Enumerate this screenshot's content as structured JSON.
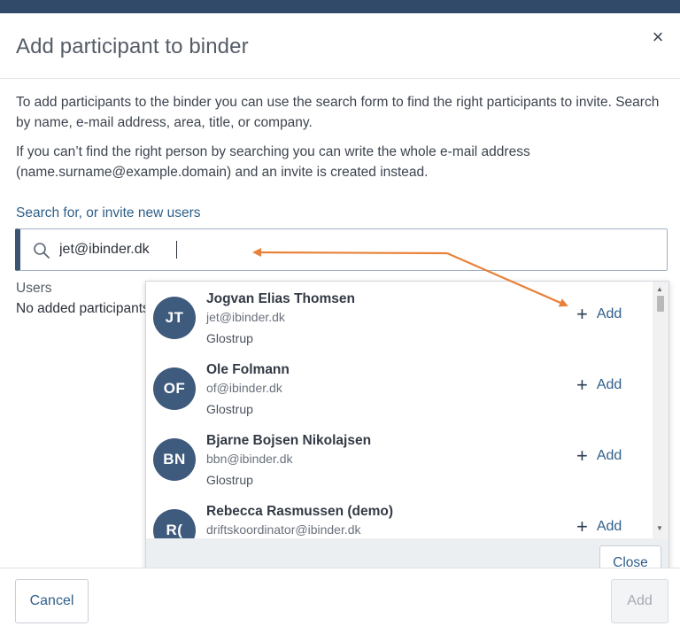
{
  "dialog": {
    "title": "Add participant to binder",
    "close_glyph": "×"
  },
  "intro": {
    "paragraph1": "To add participants to the binder you can use the search form to find the right participants to invite. Search by name, e-mail address, area, title, or company.",
    "paragraph2": "If you can’t find the right person by searching you can write the whole e-mail address (name.surname@example.domain) and an invite is created instead."
  },
  "search": {
    "label": "Search for, or invite new users",
    "value": "jet@ibinder.dk",
    "icon": "search-icon"
  },
  "users": {
    "heading": "Users",
    "empty_text": "No added participants"
  },
  "results": [
    {
      "initials": "JT",
      "name": "Jogvan Elias Thomsen",
      "email": "jet@ibinder.dk",
      "area": "Glostrup",
      "add_label": "Add"
    },
    {
      "initials": "OF",
      "name": "Ole Folmann",
      "email": "of@ibinder.dk",
      "area": "Glostrup",
      "add_label": "Add"
    },
    {
      "initials": "BN",
      "name": "Bjarne Bojsen Nikolajsen",
      "email": "bbn@ibinder.dk",
      "area": "Glostrup",
      "add_label": "Add"
    },
    {
      "initials": "R(",
      "name": "Rebecca Rasmussen (demo)",
      "email": "driftskoordinator@ibinder.dk",
      "area": "",
      "add_label": "Add"
    }
  ],
  "dropdown": {
    "close_label": "Close"
  },
  "footer": {
    "cancel_label": "Cancel",
    "add_label": "Add"
  },
  "colors": {
    "header_bar": "#324a6a",
    "avatar": "#3e5a7c",
    "link": "#2f5f8a",
    "annotation_arrow": "#e8823a"
  }
}
